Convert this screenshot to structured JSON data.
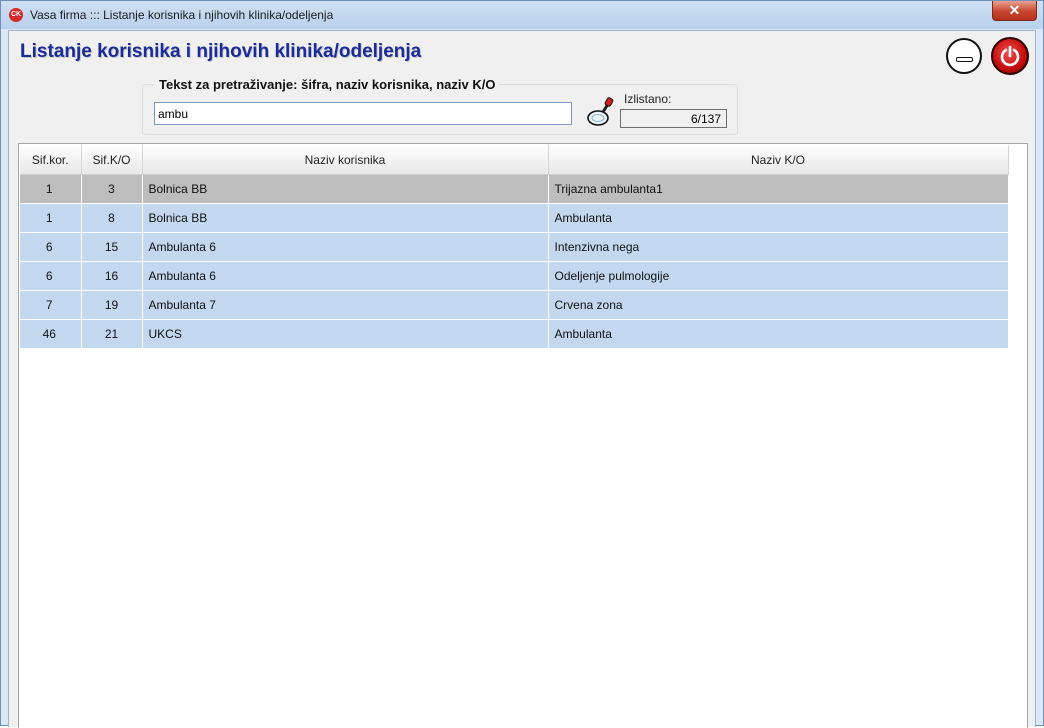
{
  "window": {
    "title": "Vasa firma ::: Listanje korisnika i njihovih klinika/odeljenja",
    "app_icon_text": "CK",
    "close_glyph": "✕"
  },
  "header": {
    "title": "Listanje korisnika i njihovih klinika/odeljenja",
    "minimize_icon": "minimize-icon",
    "power_icon": "power-icon",
    "power_color": "#d01010"
  },
  "search": {
    "legend": "Tekst za pretraživanje: šifra, naziv korisnika, naziv K/O",
    "value": "ambu",
    "icon": "magnifier-icon"
  },
  "count": {
    "label": "Izlistano:",
    "value": "6/137"
  },
  "table": {
    "columns": [
      "Sif.kor.",
      "Sif.K/O",
      "Naziv korisnika",
      "Naziv K/O"
    ],
    "rows": [
      {
        "sif_kor": "1",
        "sif_ko": "3",
        "korisnik": "Bolnica BB",
        "ko": "Trijazna ambulanta1",
        "selected": true
      },
      {
        "sif_kor": "1",
        "sif_ko": "8",
        "korisnik": "Bolnica BB",
        "ko": "Ambulanta"
      },
      {
        "sif_kor": "6",
        "sif_ko": "15",
        "korisnik": "Ambulanta 6",
        "ko": "Intenzivna nega"
      },
      {
        "sif_kor": "6",
        "sif_ko": "16",
        "korisnik": "Ambulanta 6",
        "ko": "Odeljenje pulmologije"
      },
      {
        "sif_kor": "7",
        "sif_ko": "19",
        "korisnik": "Ambulanta 7",
        "ko": "Crvena zona"
      },
      {
        "sif_kor": "46",
        "sif_ko": "21",
        "korisnik": "UKCS",
        "ko": "Ambulanta"
      }
    ],
    "row_color": "#c3d8ee",
    "selected_color": "#bdbdbd"
  }
}
